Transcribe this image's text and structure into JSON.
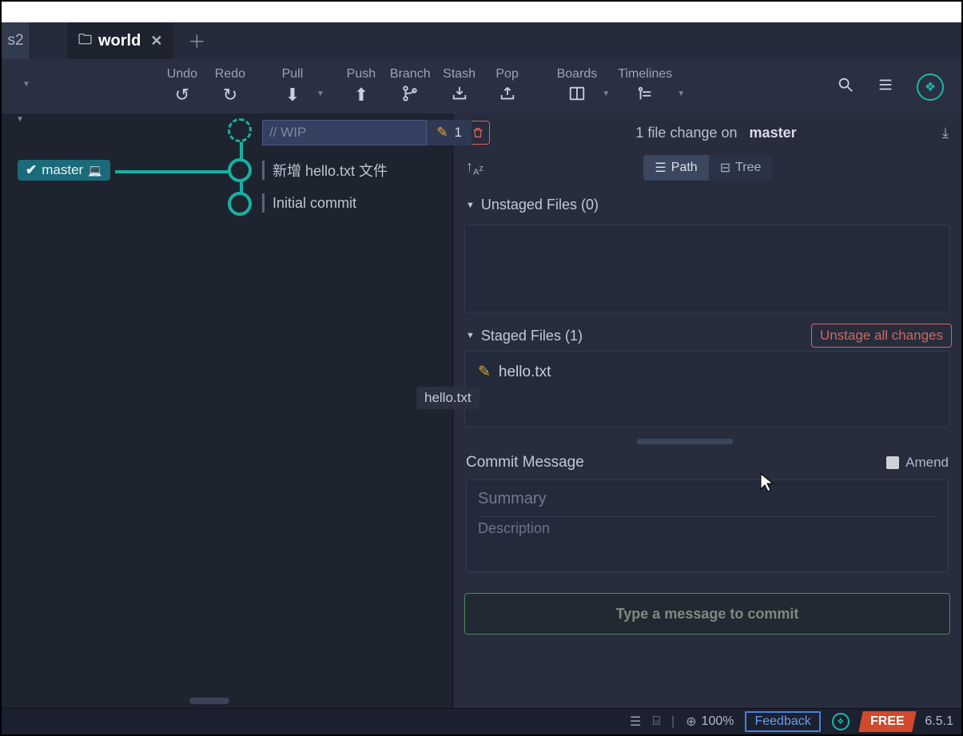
{
  "tabs": {
    "cut_label": "s2",
    "active": "world"
  },
  "toolbar": {
    "undo": "Undo",
    "redo": "Redo",
    "pull": "Pull",
    "push": "Push",
    "branch": "Branch",
    "stash": "Stash",
    "pop": "Pop",
    "boards": "Boards",
    "timelines": "Timelines"
  },
  "graph": {
    "branch_name": "master",
    "wip_label": "// WIP",
    "wip_count": "1",
    "commits": [
      "新增 hello.txt 文件",
      "Initial commit"
    ],
    "tooltip": "hello.txt"
  },
  "panel": {
    "head_prefix": "1 file change on",
    "branch": "master",
    "view_path": "Path",
    "view_tree": "Tree",
    "unstaged_title": "Unstaged Files (0)",
    "staged_title": "Staged Files (1)",
    "unstage_all": "Unstage all changes",
    "staged_files": [
      "hello.txt"
    ],
    "commit_msg_label": "Commit Message",
    "amend": "Amend",
    "summary_ph": "Summary",
    "description_ph": "Description",
    "commit_btn": "Type a message to commit"
  },
  "status": {
    "zoom": "100%",
    "feedback": "Feedback",
    "tier": "FREE",
    "version": "6.5.1"
  }
}
